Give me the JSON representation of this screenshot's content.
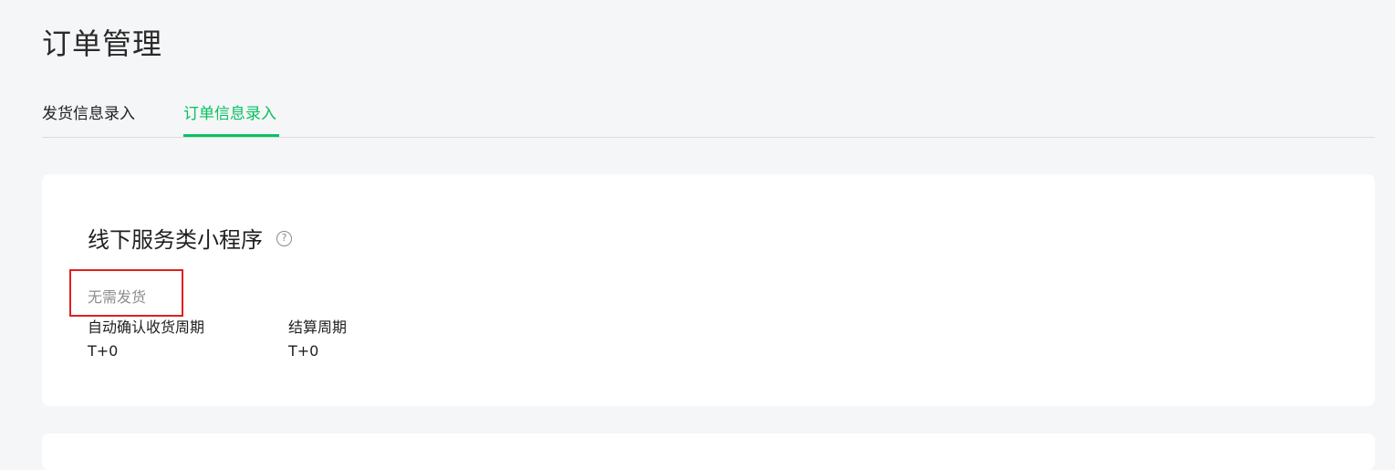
{
  "header": {
    "title": "订单管理"
  },
  "tabs": [
    {
      "label": "发货信息录入",
      "active": false
    },
    {
      "label": "订单信息录入",
      "active": true
    }
  ],
  "card": {
    "title": "线下服务类小程序",
    "help_icon": "question-circle-icon",
    "help_glyph": "?",
    "status": "无需发货",
    "fields": [
      {
        "label": "自动确认收货周期",
        "value": "T+0"
      },
      {
        "label": "结算周期",
        "value": "T+0"
      }
    ]
  },
  "colors": {
    "accent": "#07c160",
    "highlight": "#e0201d",
    "background": "#f5f6f7",
    "card": "#ffffff"
  }
}
